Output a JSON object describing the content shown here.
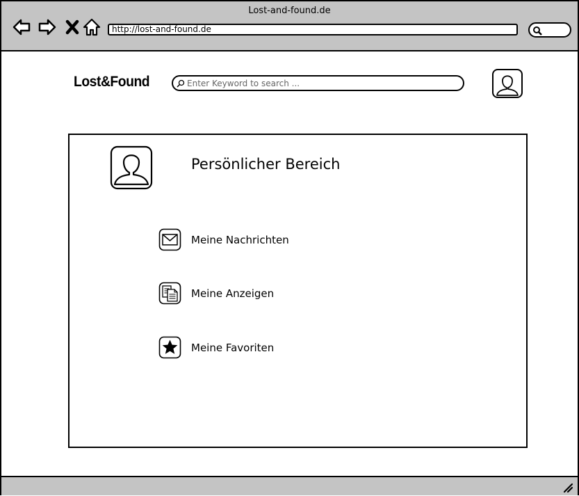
{
  "window": {
    "title": "Lost-and-found.de",
    "url": "http://lost-and-found.de"
  },
  "header": {
    "logo": "Lost&Found",
    "search_placeholder": "Enter Keyword to search ..."
  },
  "panel": {
    "title": "Persönlicher Bereich",
    "items": [
      {
        "icon": "envelope-icon",
        "label": "Meine Nachrichten"
      },
      {
        "icon": "documents-icon",
        "label": "Meine Anzeigen"
      },
      {
        "icon": "star-icon",
        "label": "Meine Favoriten"
      }
    ]
  }
}
